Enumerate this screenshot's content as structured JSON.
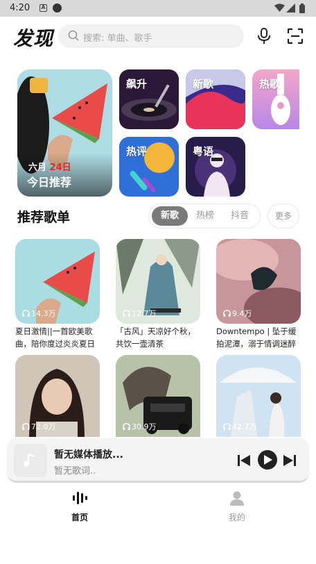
{
  "status_bar": {
    "time": "4:20",
    "notif_letter": "A"
  },
  "header": {
    "title": "发现",
    "search_placeholder": "搜索: 单曲、歌手"
  },
  "banner": {
    "daily": {
      "month": "六月",
      "day": "24日",
      "label": "今日推荐"
    },
    "tiles": [
      "飙升",
      "新歌",
      "热歌",
      "热评",
      "粤语"
    ]
  },
  "section": {
    "title": "推荐歌单",
    "tabs": [
      "新歌",
      "热榜",
      "抖音"
    ],
    "active_tab": 0,
    "more": "更多"
  },
  "playlists": [
    {
      "count": "14.3万",
      "name": "夏日激情||一首欧美歌曲，陪你度过炎炎夏日"
    },
    {
      "count": "12.7万",
      "name": "「古风」天凉好个秋，共饮一壶清茶"
    },
    {
      "count": "9.4万",
      "name": "Downtempo | 坠于缓拍泥潭，溺于情调迷醉"
    },
    {
      "count": "72.0万",
      "name": ""
    },
    {
      "count": "30.9万",
      "name": ""
    },
    {
      "count": "42.7万",
      "name": ""
    }
  ],
  "player": {
    "title": "暂无媒体播放...",
    "lyric": "暂无歌词.."
  },
  "nav": [
    {
      "label": "首页",
      "icon": "waveform-icon"
    },
    {
      "label": "我的",
      "icon": "person-icon"
    }
  ],
  "colors": {
    "accent": "#e8281e",
    "tab_active": "#7a7a7a"
  }
}
